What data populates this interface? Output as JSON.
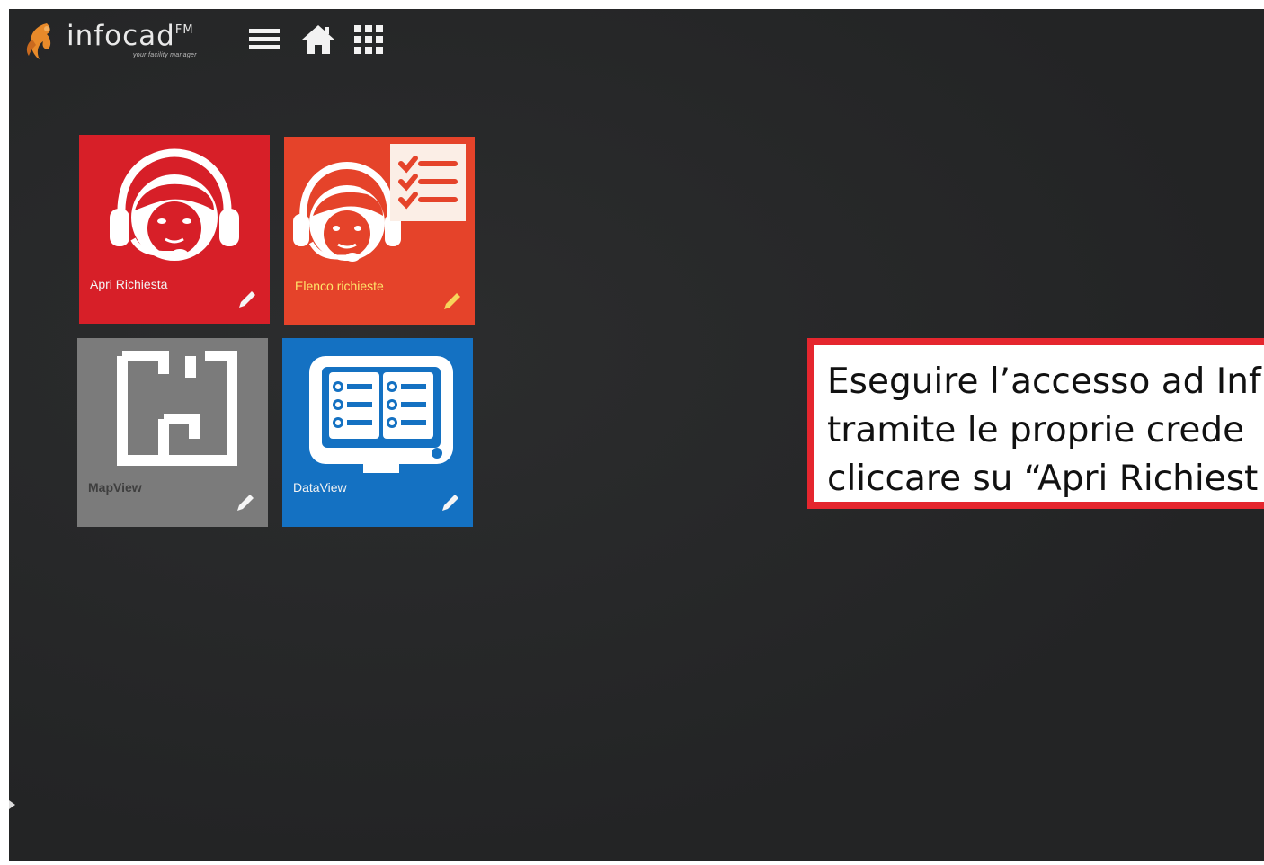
{
  "header": {
    "brand": "infocad",
    "trademark": "FM",
    "tagline": "your facility manager",
    "menu_icon": "hamburger-menu-icon",
    "home_icon": "home-icon",
    "apps_icon": "apps-grid-icon"
  },
  "tiles": [
    {
      "label": "Apri Richiesta",
      "icon": "headset-operator-icon",
      "color": "#d71f28"
    },
    {
      "label": "Elenco richieste",
      "icon": "operator-checklist-icon",
      "color": "#e5432a"
    },
    {
      "label": "MapView",
      "icon": "floorplan-icon",
      "color": "#7b7b7b"
    },
    {
      "label": "DataView",
      "icon": "data-panel-icon",
      "color": "#1471c2"
    }
  ],
  "callout": {
    "lines": [
      "Eseguire l’accesso ad Inf",
      "tramite le proprie crede",
      "cliccare su “Apri Richiest"
    ],
    "border_color": "#e5262e"
  }
}
